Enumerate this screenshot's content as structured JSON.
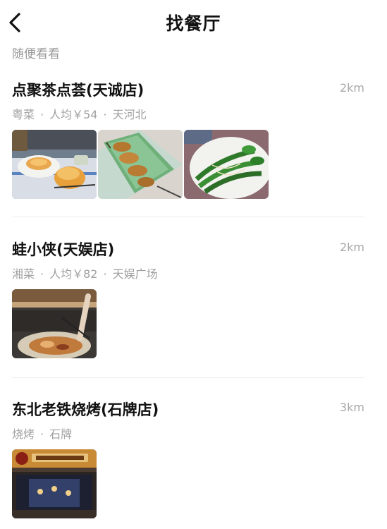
{
  "header": {
    "title": "找餐厅",
    "back_icon": "chevron-left-icon"
  },
  "section": {
    "label": "随便看看"
  },
  "restaurants": [
    {
      "name": "点聚茶点荟(天诚店)",
      "distance": "2km",
      "cuisine": "粤菜",
      "avg_price": "人均￥54",
      "area": "天河北",
      "photos": [
        "dim-sum-soup-photo",
        "fried-dumplings-photo",
        "choy-sum-photo"
      ]
    },
    {
      "name": "蛙小侠(天娱店)",
      "distance": "2km",
      "cuisine": "湘菜",
      "avg_price": "人均￥82",
      "area": "天娱广场",
      "photos": [
        "frog-hotpot-photo"
      ]
    },
    {
      "name": "东北老铁烧烤(石牌店)",
      "distance": "3km",
      "cuisine": "烧烤",
      "area": "石牌",
      "photos": [
        "storefront-photo"
      ]
    }
  ],
  "separator": "·"
}
